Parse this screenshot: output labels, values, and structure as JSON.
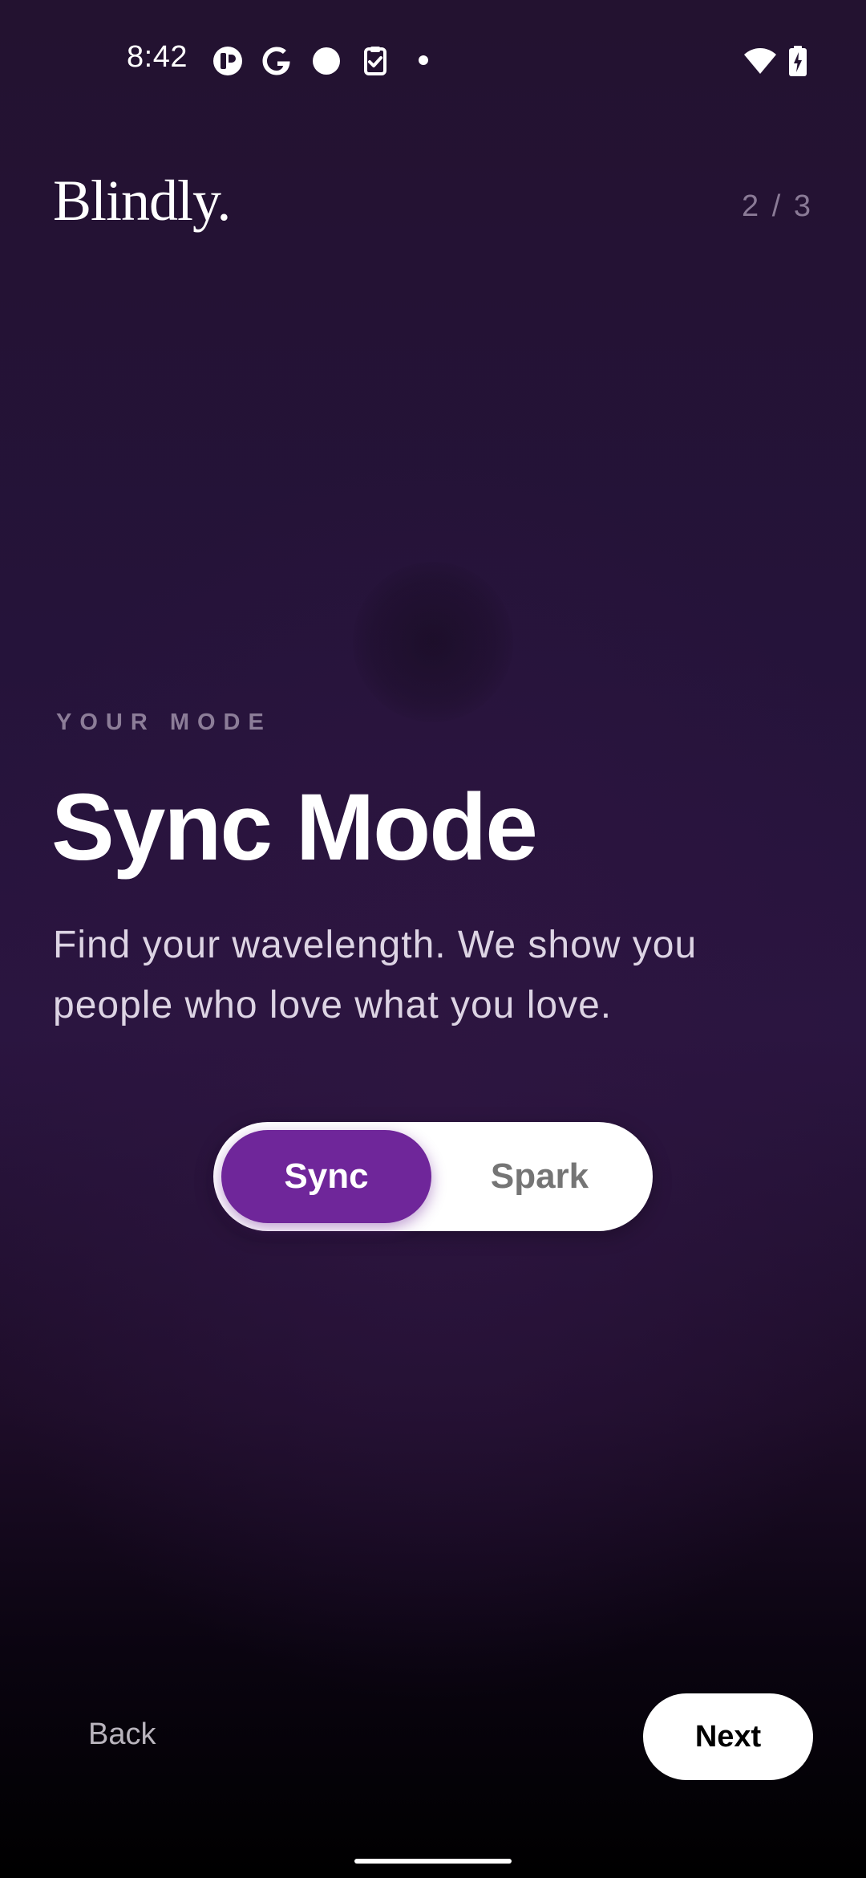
{
  "status_bar": {
    "time": "8:42",
    "icons": [
      "brand-app-icon",
      "google-g-icon",
      "circle-dot-icon",
      "clipboard-check-icon",
      "small-dot-icon",
      "wifi-icon",
      "battery-charging-icon"
    ]
  },
  "header": {
    "brand": "Blindly.",
    "step_counter": "2 / 3"
  },
  "main": {
    "eyebrow": "YOUR MODE",
    "title": "Sync Mode",
    "description": "Find your wavelength. We show you people who love what you love."
  },
  "mode_toggle": {
    "options": [
      "Sync",
      "Spark"
    ],
    "selected": "Sync"
  },
  "footer": {
    "back_label": "Back",
    "next_label": "Next"
  },
  "colors": {
    "accent": "#6f269a",
    "background_top": "#231230",
    "background_bottom": "#000000"
  }
}
